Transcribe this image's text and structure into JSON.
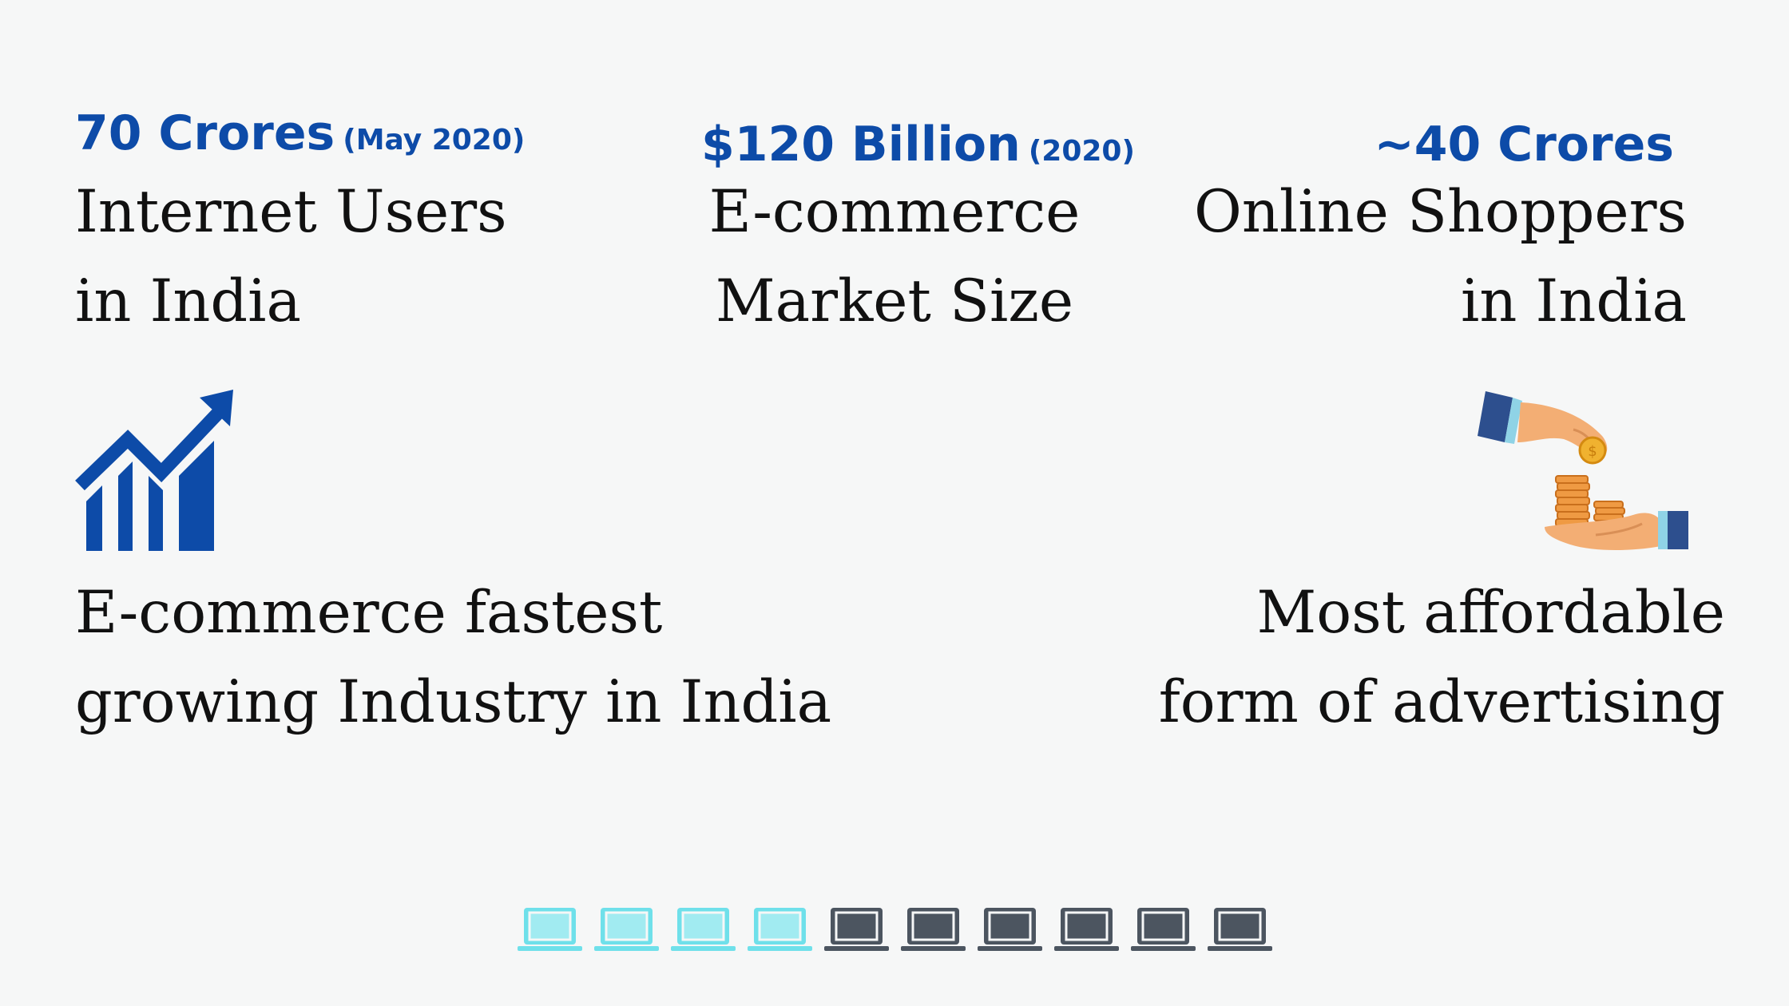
{
  "stats": [
    {
      "number": "70 Crores",
      "note": "(May 2020)",
      "line1": "Internet Users",
      "line2": "in India"
    },
    {
      "number": "$120 Billion",
      "note": "(2020)",
      "line1": "E-commerce",
      "line2": "Market Size"
    },
    {
      "number": "~40 Crores",
      "note": "",
      "line1": "Online Shoppers",
      "line2": "in India"
    }
  ],
  "facts": [
    {
      "line1": "E-commerce fastest",
      "line2": "growing Industry in India",
      "icon": "growth-chart-icon"
    },
    {
      "line1": "Most affordable",
      "line2": "form of advertising",
      "icon": "hand-coins-icon"
    }
  ],
  "laptop_indicator": {
    "total": 10,
    "highlighted": 4
  },
  "colors": {
    "accent": "#0d4ba8",
    "laptop_on": "#6fe0ea",
    "laptop_off": "#4c5560",
    "background": "#f6f7f7"
  }
}
